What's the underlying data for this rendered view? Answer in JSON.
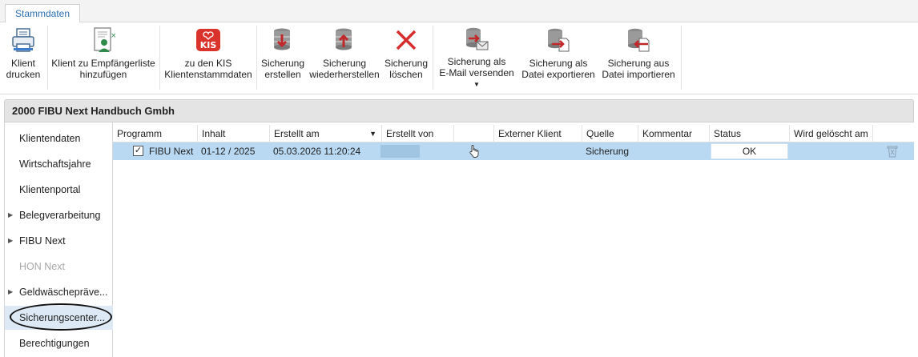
{
  "ribbon_tab": "Stammdaten",
  "ribbon": {
    "print_client": [
      "Klient",
      "drucken"
    ],
    "add_to_recipients": [
      "Klient zu Empfängerliste",
      "hinzufügen"
    ],
    "kis_logo_text": "KIS",
    "kis_master_data": [
      "zu den KIS",
      "Klientenstammdaten"
    ],
    "create_backup": [
      "Sicherung",
      "erstellen"
    ],
    "restore_backup": [
      "Sicherung",
      "wiederherstellen"
    ],
    "delete_backup": [
      "Sicherung",
      "löschen"
    ],
    "email_backup": [
      "Sicherung als",
      "E-Mail versenden"
    ],
    "export_backup": [
      "Sicherung als",
      "Datei exportieren"
    ],
    "import_backup": [
      "Sicherung aus",
      "Datei importieren"
    ]
  },
  "client_header": "2000 FIBU Next Handbuch Gmbh",
  "sidebar": {
    "items": [
      {
        "label": "Klientendaten",
        "expandable": false,
        "disabled": false
      },
      {
        "label": "Wirtschaftsjahre",
        "expandable": false,
        "disabled": false
      },
      {
        "label": "Klientenportal",
        "expandable": false,
        "disabled": false
      },
      {
        "label": "Belegverarbeitung",
        "expandable": true,
        "disabled": false
      },
      {
        "label": "FIBU Next",
        "expandable": true,
        "disabled": false
      },
      {
        "label": "HON Next",
        "expandable": false,
        "disabled": true
      },
      {
        "label": "Geldwäscheprävе...",
        "expandable": true,
        "disabled": false
      },
      {
        "label": "Sicherungscenter...",
        "expandable": false,
        "disabled": false,
        "selected": true
      },
      {
        "label": "Berechtigungen",
        "expandable": false,
        "disabled": false
      }
    ]
  },
  "grid": {
    "columns": [
      "Programm",
      "Inhalt",
      "Erstellt am",
      "Erstellt von",
      "",
      "Externer Klient",
      "Quelle",
      "Kommentar",
      "Status",
      "Wird gelöscht am"
    ],
    "rows": [
      {
        "checked": true,
        "programm": "FIBU Next",
        "inhalt": "01-12 / 2025",
        "erstellt_am": "05.03.2026 11:20:24",
        "quelle": "Sicherung",
        "status": "OK"
      }
    ]
  },
  "colors": {
    "accent": "#2a6db0",
    "selected_row": "#b9d9f2",
    "kis_red": "#d9332b",
    "delete_red": "#d62d2d"
  }
}
